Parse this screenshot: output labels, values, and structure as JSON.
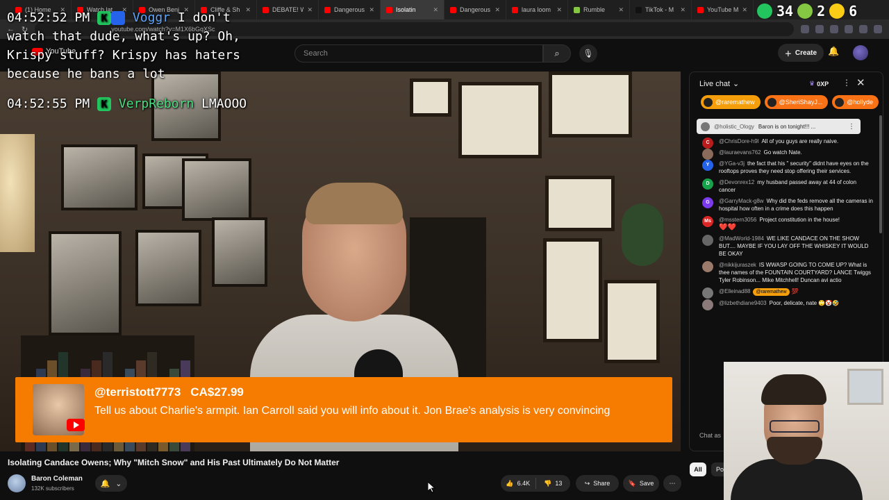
{
  "browser": {
    "tabs": [
      {
        "label": "(1) Home",
        "color": "#ff0000",
        "active": false
      },
      {
        "label": "Watch lat",
        "color": "#ff0000",
        "active": false
      },
      {
        "label": "Owen Benj",
        "color": "#ff0000",
        "active": false
      },
      {
        "label": "Cliffe & Sh",
        "color": "#ff0000",
        "active": false
      },
      {
        "label": "DEBATE! W",
        "color": "#ff0000",
        "active": false
      },
      {
        "label": "Dangerous",
        "color": "#ff0000",
        "active": false
      },
      {
        "label": "Isolatin",
        "color": "#ff0000",
        "active": true
      },
      {
        "label": "Dangerous",
        "color": "#ff0000",
        "active": false
      },
      {
        "label": "laura loom",
        "color": "#ff0000",
        "active": false
      },
      {
        "label": "Rumble",
        "color": "#85c742",
        "active": false
      },
      {
        "label": "TikTok - M",
        "color": "#111111",
        "active": false
      },
      {
        "label": "YouTube M",
        "color": "#ff0000",
        "active": false
      }
    ],
    "new_tab": "+",
    "url": "youtube.com/watch?v=M1X6bGqXSc"
  },
  "youtube_header": {
    "logo_text": "YouTube",
    "search_placeholder": "Search",
    "create_label": "Create"
  },
  "stream_overlay": {
    "line1_time": "04:52:52 PM",
    "line1_user": "Voggr",
    "line1_text": "I don't",
    "line2": "watch that dude, what's up? Oh,",
    "line3": "Krispy stuff? Krispy has haters",
    "line4": "because he bans a lot",
    "line5_time": "04:52:55 PM",
    "line5_user": "VerpReborn",
    "line5_text": "LMAOOO",
    "counter1": "34",
    "counter2": "2",
    "counter3": "6"
  },
  "superchat": {
    "user": "@terristott7773",
    "amount": "CA$27.99",
    "message": "Tell us about Charlie's armpit. Ian Carroll said you will info about it. Jon Brae's analysis is very convincing"
  },
  "video": {
    "title": "Isolating Candace Owens; Why \"Mitch Snow\" and His Past Ultimately Do Not Matter",
    "channel": "Baron Coleman",
    "subscribers": "132K subscribers",
    "likes": "6.4K",
    "dislikes": "13",
    "share_label": "Share",
    "save_label": "Save"
  },
  "live_chat": {
    "header": "Live chat",
    "xp": "0XP",
    "tickers": [
      {
        "label": "@raremathew",
        "color": "#f59e0b"
      },
      {
        "label": "@SheriShayJ...",
        "color": "#f97316"
      },
      {
        "label": "@hollyde",
        "color": "#f97316"
      }
    ],
    "pinned": {
      "user": "@holistic_Ology",
      "text": "Baron is on tonight!!! ..."
    },
    "messages": [
      {
        "user": "@ChrisDore-h9l",
        "text": "All of you guys are really naive.",
        "initial": "C",
        "color": "#b91c1c"
      },
      {
        "user": "@lauraevans762",
        "text": "Go watch Nate.",
        "initial": "",
        "color": "#8a6a5a"
      },
      {
        "user": "@YGa-v3j",
        "text": "the fact that his \" security\" didnt have eyes on the rooftops proves they need stop offering their services.",
        "initial": "Y",
        "color": "#2563eb"
      },
      {
        "user": "@Devonrex12",
        "text": "my husband passed away at 44 of colon cancer",
        "initial": "D",
        "color": "#16a34a"
      },
      {
        "user": "@GarryMack-g8w",
        "text": "Why did the feds remove all the cameras in hospital how often in a crime does this happen",
        "initial": "G",
        "color": "#7c3aed"
      },
      {
        "user": "@msstern3056",
        "text": "Project constitution in the house!",
        "initial": "Ms",
        "color": "#dc2626",
        "hearts": "❤️❤️"
      },
      {
        "user": "@MadWorld-1984",
        "text": "WE LIKE CANDACE ON THE SHOW BUT.... MAYBE IF YOU LAY OFF THE WHISKEY IT WOULD BE OKAY",
        "initial": "",
        "color": "#666666"
      },
      {
        "user": "@nikkijuraszek",
        "text": "IS WWASP GOING TO COME UP? What is thee names of the FOUNTAIN COURTYARD? LANCE Twiggs Tyler Robinson... Mike Mitchhell! Duncan avi actio",
        "initial": "",
        "color": "#9a7a6a"
      },
      {
        "user": "@Elleinad88",
        "text": "💯",
        "initial": "",
        "color": "#777777",
        "mention": "@raremathew"
      },
      {
        "user": "@lizbethdiane9403",
        "text": "Poor, delicate, nate 🙄🤡🤣",
        "initial": "",
        "color": "#8a7a7a"
      }
    ],
    "input_placeholder": "Chat as",
    "chip_all": "All",
    "chip_po": "Po"
  }
}
